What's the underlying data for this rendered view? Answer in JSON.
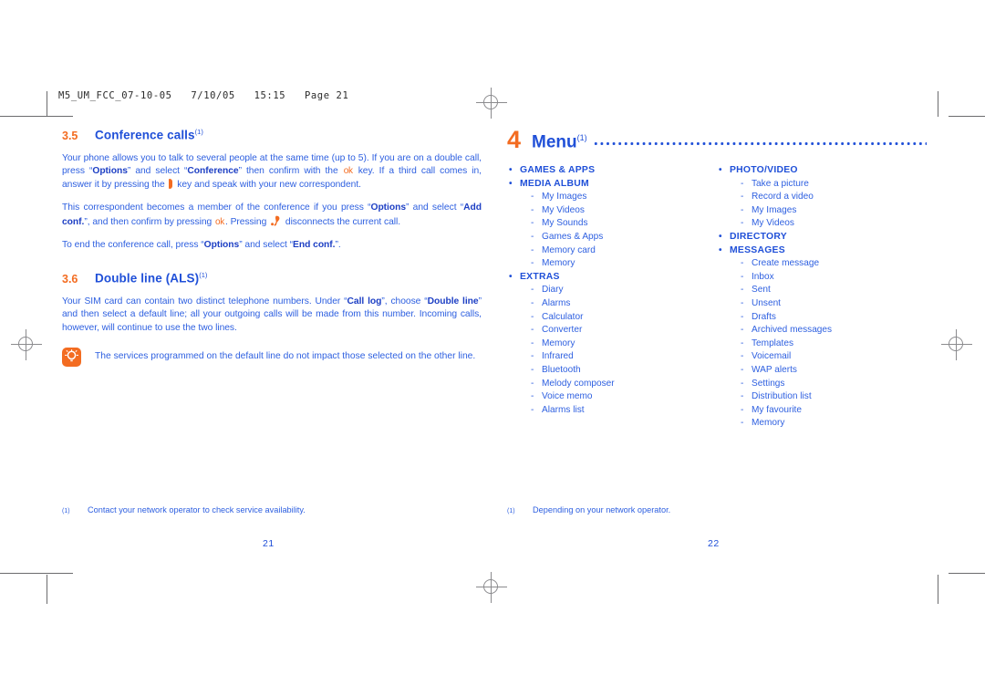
{
  "file_header": "M5_UM_FCC_07-10-05   7/10/05   15:15   Page 21",
  "colors": {
    "accent_orange": "#f36c21",
    "text_blue": "#2d5fe0",
    "heading_blue": "#2050d8",
    "mark_gray": "#6b6b6e"
  },
  "left_page": {
    "sections": [
      {
        "number": "3.5",
        "title": "Conference calls",
        "footnote_mark": "(1)"
      },
      {
        "number": "3.6",
        "title": "Double line (ALS)",
        "footnote_mark": "(1)"
      }
    ],
    "para_1": {
      "t1": "Your phone allows you to talk to several people at the same time (up to 5). If you are on a double call, press “",
      "b1": "Options",
      "t2": "” and select “",
      "b2": "Conference",
      "t3": "” then confirm with the ",
      "key1": "ok",
      "t4": " key. If a third call comes in, answer it by pressing the ",
      "key2": "pickup-key-icon",
      "t5": " key and speak with your new correspondent."
    },
    "para_2": {
      "t1": "This correspondent becomes a member of the conference if you press “",
      "b1": "Options",
      "t2": "” and select “",
      "b2": "Add conf.",
      "t3": "”, and then confirm by pressing ",
      "key1": "ok",
      "t4": ". Pressing ",
      "key2": "hangup-key-icon",
      "t5": " disconnects the current call."
    },
    "para_3": {
      "t1": "To end the conference call, press “",
      "b1": "Options",
      "t2": "” and select “",
      "b2": "End conf.",
      "t3": "”."
    },
    "para_4": {
      "t1": "Your SIM card can contain two distinct telephone numbers. Under “",
      "b1": "Call log",
      "t2": "”, choose “",
      "b2": "Double line",
      "t3": "” and then select a default line; all your outgoing calls will be made from this number. Incoming calls, however, will continue to use the two lines."
    },
    "note": {
      "icon": "tip-bulb-icon",
      "text": "The services programmed on the default line do not impact those selected on the other line."
    },
    "footnote": {
      "mark": "(1)",
      "text": "Contact your network operator to check service availability."
    },
    "page_number": "21"
  },
  "right_page": {
    "chapter": {
      "number": "4",
      "title": "Menu",
      "footnote_mark": "(1)"
    },
    "menu_column_1": [
      {
        "type": "top",
        "label": "GAMES & APPS"
      },
      {
        "type": "top",
        "label": "MEDIA ALBUM"
      },
      {
        "type": "sub",
        "label": "My Images"
      },
      {
        "type": "sub",
        "label": "My Videos"
      },
      {
        "type": "sub",
        "label": "My Sounds"
      },
      {
        "type": "sub",
        "label": "Games & Apps"
      },
      {
        "type": "sub",
        "label": "Memory card"
      },
      {
        "type": "sub",
        "label": "Memory"
      },
      {
        "type": "top",
        "label": "EXTRAS"
      },
      {
        "type": "sub",
        "label": "Diary"
      },
      {
        "type": "sub",
        "label": "Alarms"
      },
      {
        "type": "sub",
        "label": "Calculator"
      },
      {
        "type": "sub",
        "label": "Converter"
      },
      {
        "type": "sub",
        "label": "Memory"
      },
      {
        "type": "sub",
        "label": "Infrared"
      },
      {
        "type": "sub",
        "label": "Bluetooth"
      },
      {
        "type": "sub",
        "label": "Melody composer"
      },
      {
        "type": "sub",
        "label": "Voice memo"
      },
      {
        "type": "sub",
        "label": "Alarms list"
      }
    ],
    "menu_column_2": [
      {
        "type": "top",
        "label": "PHOTO/VIDEO"
      },
      {
        "type": "sub",
        "label": "Take a picture"
      },
      {
        "type": "sub",
        "label": "Record a video"
      },
      {
        "type": "sub",
        "label": "My Images"
      },
      {
        "type": "sub",
        "label": "My Videos"
      },
      {
        "type": "top",
        "label": "DIRECTORY"
      },
      {
        "type": "top",
        "label": "MESSAGES"
      },
      {
        "type": "sub",
        "label": "Create message"
      },
      {
        "type": "sub",
        "label": "Inbox"
      },
      {
        "type": "sub",
        "label": "Sent"
      },
      {
        "type": "sub",
        "label": "Unsent"
      },
      {
        "type": "sub",
        "label": "Drafts"
      },
      {
        "type": "sub",
        "label": "Archived messages"
      },
      {
        "type": "sub",
        "label": "Templates"
      },
      {
        "type": "sub",
        "label": "Voicemail"
      },
      {
        "type": "sub",
        "label": "WAP alerts"
      },
      {
        "type": "sub",
        "label": "Settings"
      },
      {
        "type": "sub",
        "label": "Distribution list"
      },
      {
        "type": "sub",
        "label": "My favourite"
      },
      {
        "type": "sub",
        "label": "Memory"
      }
    ],
    "footnote": {
      "mark": "(1)",
      "text": "Depending on your network operator."
    },
    "page_number": "22"
  }
}
